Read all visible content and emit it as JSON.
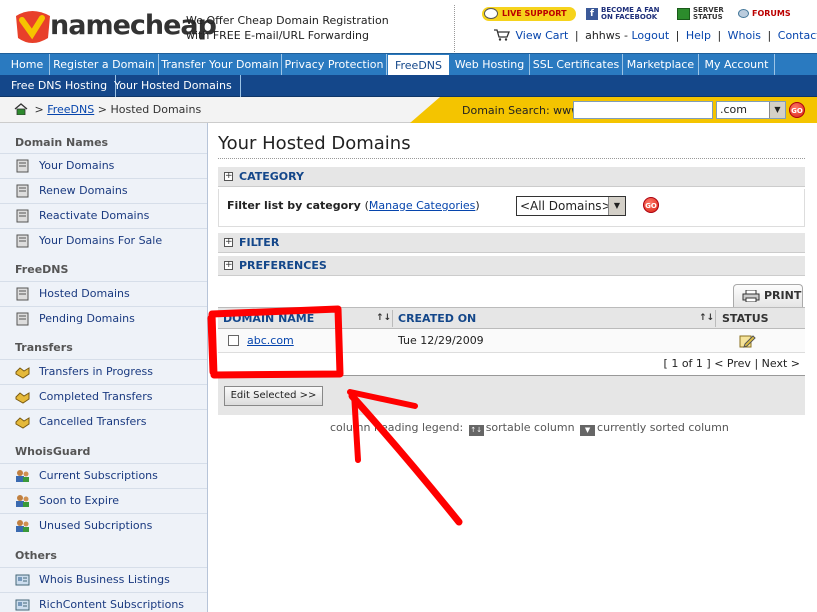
{
  "header": {
    "logo_text": "namecheap",
    "tagline_line1": "We Offer Cheap Domain Registration",
    "tagline_line2": "with FREE E-mail/URL Forwarding",
    "badges": {
      "live_support": "LIVE SUPPORT",
      "facebook_line1": "BECOME A FAN",
      "facebook_line2": "ON FACEBOOK",
      "server_line1": "SERVER",
      "server_line2": "STATUS",
      "forums": "FORUMS"
    },
    "toplinks": {
      "view_cart": "View Cart",
      "username": "ahhws",
      "logout": "Logout",
      "help": "Help",
      "whois": "Whois",
      "contact": "Contact Us"
    }
  },
  "nav": {
    "items": [
      {
        "label": "Home"
      },
      {
        "label": "Register a Domain"
      },
      {
        "label": "Transfer Your Domain"
      },
      {
        "label": "Privacy Protection"
      },
      {
        "label": "FreeDNS"
      },
      {
        "label": "Web Hosting"
      },
      {
        "label": "SSL Certificates"
      },
      {
        "label": "Marketplace"
      },
      {
        "label": "My Account"
      }
    ],
    "active": "FreeDNS"
  },
  "subnav": {
    "items": [
      {
        "label": "Free DNS Hosting"
      },
      {
        "label": "Your Hosted Domains"
      }
    ]
  },
  "breadcrumb": {
    "sep": ">",
    "link": "FreeDNS",
    "current": "Hosted Domains"
  },
  "domain_search": {
    "label": "Domain Search: www.",
    "value": "",
    "tld": ".com",
    "go": "GO"
  },
  "sidebar": {
    "sections": [
      {
        "title": "Domain Names",
        "items": [
          "Your Domains",
          "Renew Domains",
          "Reactivate Domains",
          "Your Domains For Sale"
        ]
      },
      {
        "title": "FreeDNS",
        "items": [
          "Hosted Domains",
          "Pending Domains"
        ]
      },
      {
        "title": "Transfers",
        "items": [
          "Transfers in Progress",
          "Completed Transfers",
          "Cancelled Transfers"
        ]
      },
      {
        "title": "WhoisGuard",
        "items": [
          "Current Subscriptions",
          "Soon to Expire",
          "Unused Subcriptions"
        ]
      },
      {
        "title": "Others",
        "items": [
          "Whois Business Listings",
          "RichContent Subscriptions"
        ]
      }
    ]
  },
  "main": {
    "title": "Your Hosted Domains",
    "category_bar": "CATEGORY",
    "filter_label": "Filter list by category",
    "manage_categories": "Manage Categories",
    "category_select": "<All Domains>",
    "filter_bar": "FILTER",
    "preferences_bar": "PREFERENCES",
    "print": "PRINT",
    "table": {
      "columns": [
        "DOMAIN NAME",
        "CREATED ON",
        "STATUS"
      ],
      "sort_glyph": "↑↓",
      "rows": [
        {
          "domain": "abc.com",
          "created": "Tue 12/29/2009"
        }
      ]
    },
    "pager": {
      "position": "[ 1 of 1 ]",
      "prev": "< Prev",
      "next": "Next >"
    },
    "edit_selected": "Edit Selected >>",
    "legend": {
      "prefix": "column heading legend:",
      "sortable": "sortable column",
      "sorted": "currently sorted column"
    }
  },
  "colors": {
    "nav_blue": "#2a7ac0",
    "subnav_navy": "#14478a",
    "search_yellow": "#f4c400",
    "annotation_red": "#ff0000"
  }
}
